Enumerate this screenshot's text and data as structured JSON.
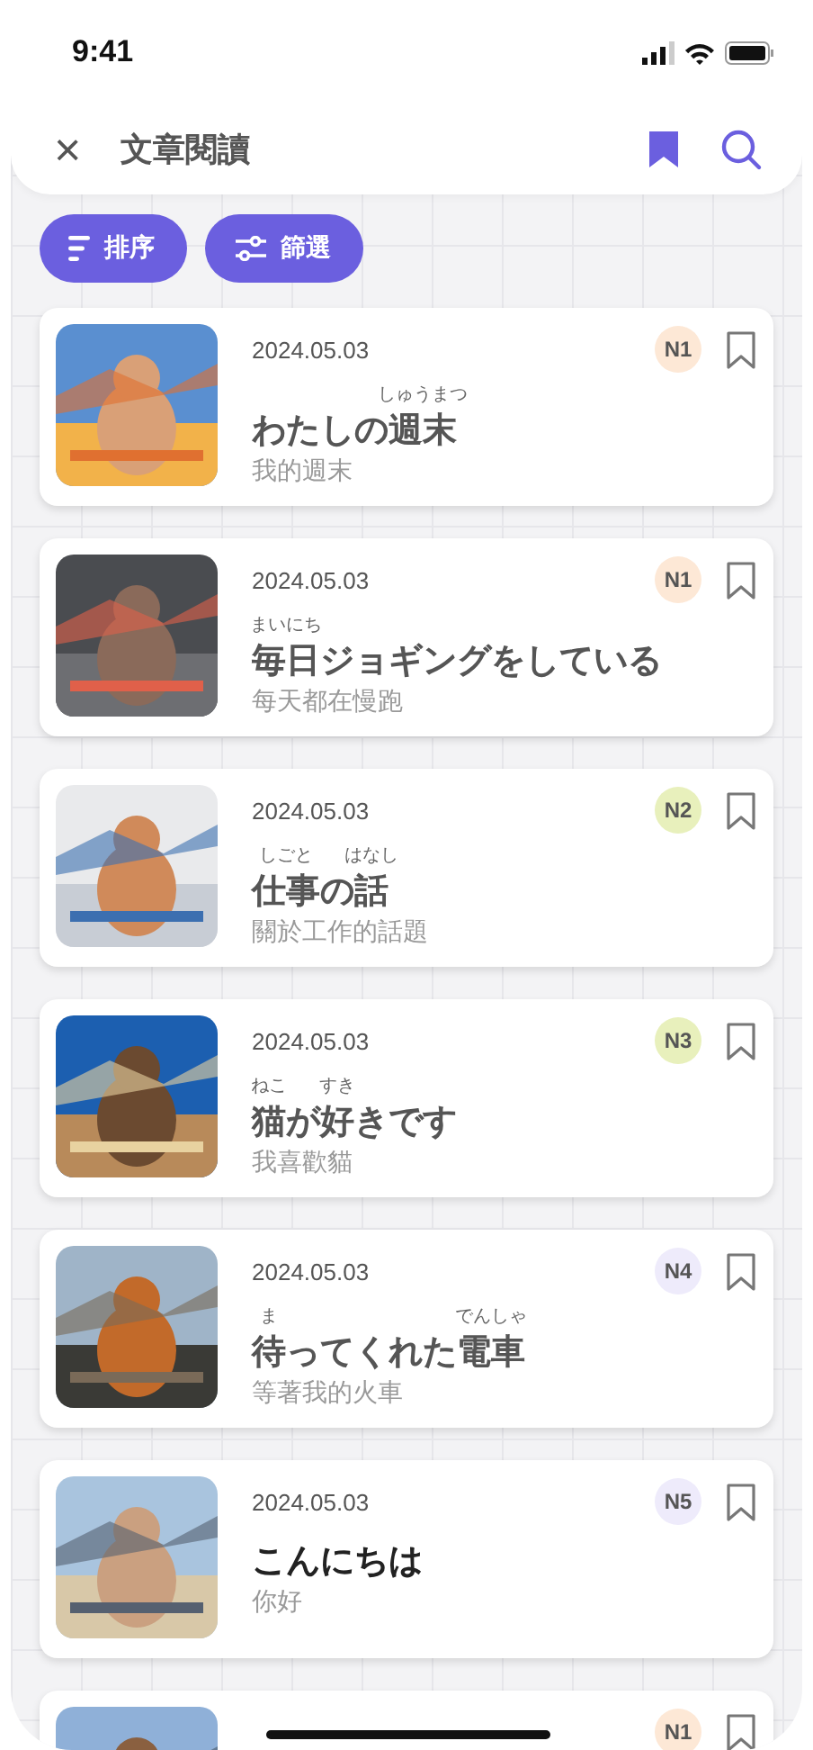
{
  "status_bar": {
    "time": "9:41"
  },
  "header": {
    "close": "×",
    "title": "文章閱讀"
  },
  "toolbar": [
    {
      "kind": "sort",
      "label": "排序"
    },
    {
      "kind": "filter",
      "label": "篩選"
    }
  ],
  "articles": [
    {
      "date": "2024.05.03",
      "level": "N1",
      "color": "#fde8d6",
      "bookmarked": false,
      "title": [
        {
          "text": "わたしの"
        },
        {
          "text": "週末",
          "ruby": "しゅうまつ"
        }
      ],
      "translation": "我的週末"
    },
    {
      "date": "2024.05.03",
      "level": "N1",
      "color": "#fde8d6",
      "bookmarked": false,
      "title": [
        {
          "text": "毎日",
          "ruby": "まいにち"
        },
        {
          "text": "ジョギングをしている"
        }
      ],
      "translation": "每天都在慢跑"
    },
    {
      "date": "2024.05.03",
      "level": "N2",
      "color": "#e8f0bc",
      "bookmarked": false,
      "title": [
        {
          "text": "仕事",
          "ruby": "しごと"
        },
        {
          "text": "の"
        },
        {
          "text": "話",
          "ruby": "はなし"
        }
      ],
      "translation": "關於工作的話題"
    },
    {
      "date": "2024.05.03",
      "level": "N3",
      "color": "#e8f0bc",
      "bookmarked": false,
      "title": [
        {
          "text": "猫",
          "ruby": "ねこ"
        },
        {
          "text": "が"
        },
        {
          "text": "好",
          "ruby": "すき"
        },
        {
          "text": "きです"
        }
      ],
      "translation": "我喜歡貓"
    },
    {
      "date": "2024.05.03",
      "level": "N4",
      "color": "#eeebfb",
      "bookmarked": false,
      "title": [
        {
          "text": "待",
          "ruby": "ま"
        },
        {
          "text": "ってくれた"
        },
        {
          "text": "電車",
          "ruby": "でんしゃ"
        }
      ],
      "translation": "等著我的火車"
    },
    {
      "date": "2024.05.03",
      "level": "N5",
      "color": "#eeebfb",
      "bookmarked": false,
      "title": [
        {
          "text": "こんにちは"
        }
      ],
      "translation": "你好"
    },
    {
      "level": "N1",
      "color": "#fde8d6",
      "bookmarked": false
    }
  ]
}
